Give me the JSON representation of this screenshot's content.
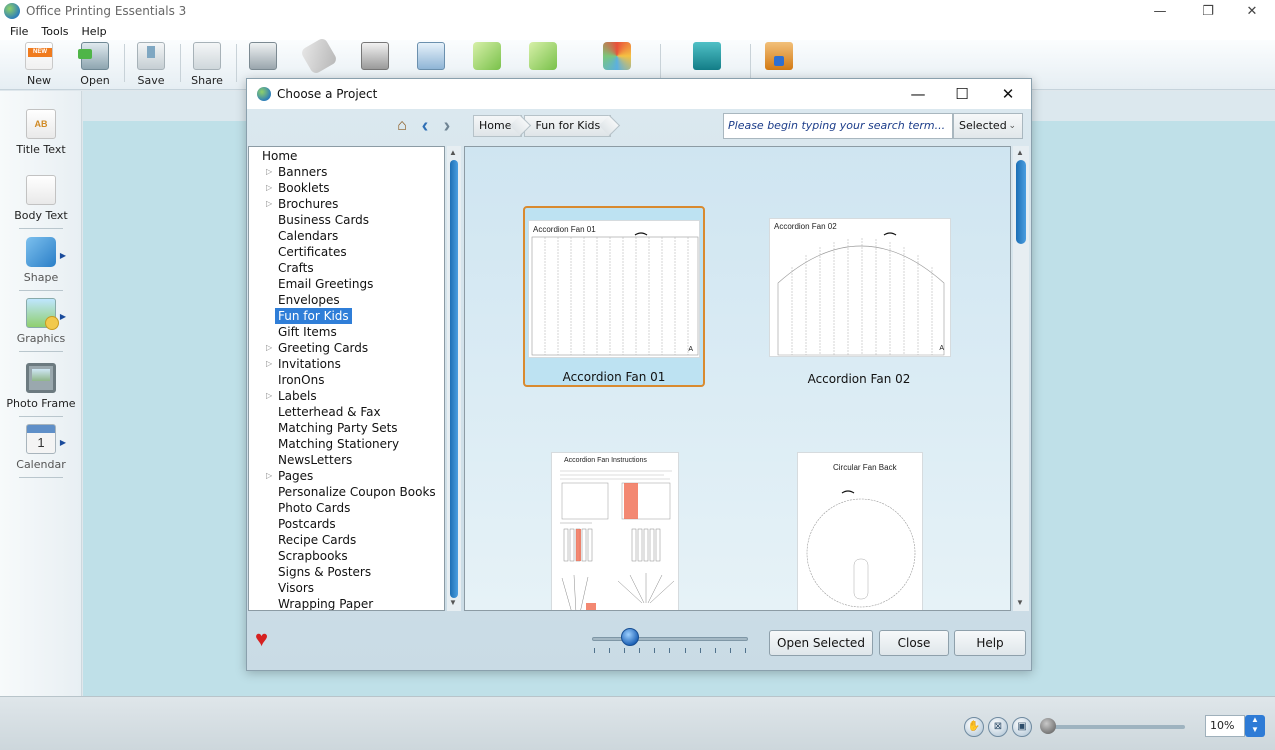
{
  "app": {
    "title": "Office Printing Essentials 3",
    "window_controls": {
      "minimize": "—",
      "restore": "❐",
      "close": "✕"
    }
  },
  "menu": [
    "File",
    "Tools",
    "Help"
  ],
  "toolbar": {
    "new_label": "New",
    "open_label": "Open",
    "save_label": "Save",
    "share_label": "Share"
  },
  "sidepanel": {
    "title_text": "Title Text",
    "body_text": "Body Text",
    "shape": "Shape",
    "graphics": "Graphics",
    "photo_frame": "Photo Frame",
    "calendar": "Calendar"
  },
  "statusbar": {
    "zoom_value": "10%"
  },
  "dialog": {
    "title": "Choose a Project",
    "controls": {
      "minimize": "—",
      "maximize": "☐",
      "close": "✕"
    },
    "breadcrumb": [
      "Home",
      "Fun for Kids"
    ],
    "search_placeholder": "Please begin typing your search term...",
    "filter_value": "Selected",
    "tree": {
      "root": "Home",
      "items": [
        {
          "label": "Banners",
          "expandable": true
        },
        {
          "label": "Booklets",
          "expandable": true
        },
        {
          "label": "Brochures",
          "expandable": true
        },
        {
          "label": "Business Cards",
          "expandable": false
        },
        {
          "label": "Calendars",
          "expandable": false
        },
        {
          "label": "Certificates",
          "expandable": false
        },
        {
          "label": "Crafts",
          "expandable": false
        },
        {
          "label": "Email Greetings",
          "expandable": false
        },
        {
          "label": "Envelopes",
          "expandable": false
        },
        {
          "label": "Fun for Kids",
          "expandable": false,
          "selected": true
        },
        {
          "label": "Gift Items",
          "expandable": false
        },
        {
          "label": "Greeting Cards",
          "expandable": true
        },
        {
          "label": "Invitations",
          "expandable": true
        },
        {
          "label": "IronOns",
          "expandable": false
        },
        {
          "label": "Labels",
          "expandable": true
        },
        {
          "label": "Letterhead & Fax",
          "expandable": false
        },
        {
          "label": "Matching Party Sets",
          "expandable": false
        },
        {
          "label": "Matching Stationery",
          "expandable": false
        },
        {
          "label": "NewsLetters",
          "expandable": false
        },
        {
          "label": "Pages",
          "expandable": true
        },
        {
          "label": "Personalize Coupon Books",
          "expandable": false
        },
        {
          "label": "Photo Cards",
          "expandable": false
        },
        {
          "label": "Postcards",
          "expandable": false
        },
        {
          "label": "Recipe Cards",
          "expandable": false
        },
        {
          "label": "Scrapbooks",
          "expandable": false
        },
        {
          "label": "Signs & Posters",
          "expandable": false
        },
        {
          "label": "Visors",
          "expandable": false
        },
        {
          "label": "Wrapping Paper",
          "expandable": false
        }
      ]
    },
    "projects": [
      {
        "label": "Accordion Fan 01",
        "thumb_title": "Accordion Fan 01",
        "selected": true
      },
      {
        "label": "Accordion Fan 02",
        "thumb_title": "Accordion Fan 02",
        "selected": false
      },
      {
        "label": "",
        "thumb_title": "Accordion Fan Instructions",
        "selected": false
      },
      {
        "label": "",
        "thumb_title": "Circular Fan Back",
        "selected": false
      }
    ],
    "thumb_corner": "A",
    "buttons": {
      "open_selected": "Open Selected",
      "close": "Close",
      "help": "Help"
    },
    "size_slider_value": 0.25
  }
}
